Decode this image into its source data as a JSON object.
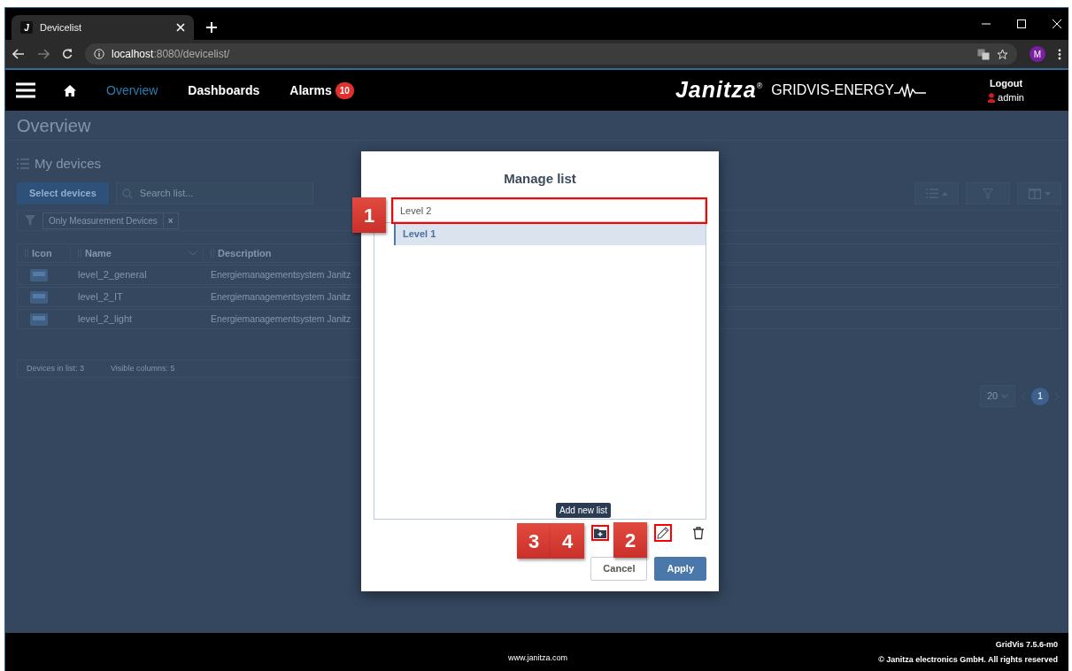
{
  "browser": {
    "tab": {
      "favicon": "J",
      "title": "Devicelist"
    },
    "url": {
      "host": "localhost",
      "path": ":8080/devicelist/"
    },
    "avatar": "M"
  },
  "navbar": {
    "items": [
      {
        "label": "Overview",
        "selected": true
      },
      {
        "label": "Dashboards",
        "selected": false
      },
      {
        "label": "Alarms",
        "selected": false,
        "badge": "10"
      }
    ],
    "logo": "Janitza",
    "logo_mark": "®",
    "product": "GRIDVIS-ENERGY",
    "logout": "Logout",
    "user": "admin"
  },
  "page": {
    "title": "Overview",
    "section": "My devices",
    "select_button": "Select devices",
    "search": {
      "placeholder": "Search list..."
    },
    "filter_chip": {
      "label": "Only Measurement Devices",
      "remove": "×"
    },
    "columns": [
      "Icon",
      "Name",
      "Description"
    ],
    "rows": [
      {
        "name": "level_2_general",
        "description": "Energiemanagementsystem Janitz"
      },
      {
        "name": "level_2_IT",
        "description": "Energiemanagementsystem Janitz"
      },
      {
        "name": "level_2_light",
        "description": "Energiemanagementsystem Janitz"
      }
    ],
    "status": [
      "Devices in list: 3",
      "Visible columns: 5"
    ],
    "pagination": {
      "page_size": "20",
      "pages": [
        {
          "label": "1",
          "selected": true
        }
      ]
    }
  },
  "modal": {
    "title": "Manage list",
    "input": {
      "value": "Level 2",
      "highlighted": true,
      "callouts": [
        "1"
      ]
    },
    "lists": [
      {
        "label": "Level 1",
        "selected": true
      }
    ],
    "tools": [
      {
        "kind": "add",
        "highlighted": true,
        "callouts": [
          "3",
          "4"
        ],
        "tooltip": "Add new list"
      },
      {
        "kind": "rename",
        "highlighted": true,
        "callouts": [
          "2"
        ]
      },
      {
        "kind": "delete",
        "highlighted": false
      }
    ],
    "buttons": [
      {
        "label": "Cancel",
        "kind": "secondary"
      },
      {
        "label": "Apply",
        "kind": "primary"
      }
    ]
  },
  "footer": {
    "link": "www.janitza.com",
    "version": "GridVis 7.5.6-m0",
    "copyright": "© Janitza electronics GmbH. All rights reserved"
  }
}
